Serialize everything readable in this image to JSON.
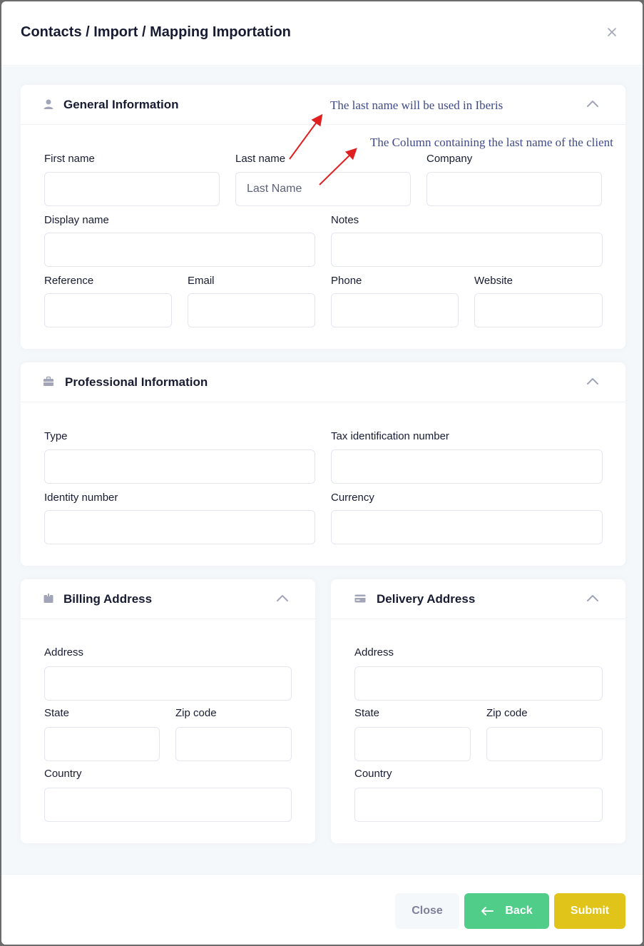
{
  "modal": {
    "title": "Contacts / Import / Mapping Importation"
  },
  "annotations": {
    "note1": "The last name will be used in Iberis",
    "note2": "The Column containing the last name of the client",
    "arrow_color": "#e02020"
  },
  "general": {
    "title": "General Information",
    "icon": "user-icon",
    "first_name_label": "First name",
    "last_name_label": "Last name",
    "last_name_value": "Last Name",
    "company_label": "Company",
    "display_name_label": "Display name",
    "notes_label": "Notes",
    "reference_label": "Reference",
    "email_label": "Email",
    "phone_label": "Phone",
    "website_label": "Website"
  },
  "professional": {
    "title": "Professional Information",
    "icon": "briefcase-icon",
    "type_label": "Type",
    "tax_label": "Tax identification number",
    "identity_label": "Identity number",
    "currency_label": "Currency"
  },
  "billing": {
    "title": "Billing Address",
    "icon": "box-icon",
    "address_label": "Address",
    "state_label": "State",
    "zip_label": "Zip code",
    "country_label": "Country"
  },
  "delivery": {
    "title": "Delivery Address",
    "icon": "credit-card-icon",
    "address_label": "Address",
    "state_label": "State",
    "zip_label": "Zip code",
    "country_label": "Country"
  },
  "footer": {
    "close_label": "Close",
    "back_label": "Back",
    "submit_label": "Submit"
  },
  "colors": {
    "back": "#50cd89",
    "submit": "#e0c419",
    "close": "#f5f8fa"
  }
}
